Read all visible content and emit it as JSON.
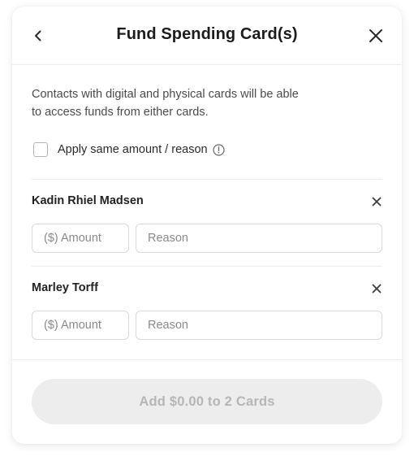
{
  "header": {
    "title": "Fund Spending Card(s)",
    "back_icon": "chevron-left-icon",
    "close_icon": "close-icon"
  },
  "description": "Contacts with digital and physical cards will be able to access funds from either cards.",
  "apply_same": {
    "label": "Apply same amount / reason",
    "checked": false,
    "info_icon": "info-icon"
  },
  "recipients": [
    {
      "name": "Kadin Rhiel Madsen",
      "amount_placeholder": "($) Amount",
      "reason_placeholder": "Reason",
      "remove_icon": "close-icon"
    },
    {
      "name": "Marley Torff",
      "amount_placeholder": "($) Amount",
      "reason_placeholder": "Reason",
      "remove_icon": "close-icon"
    }
  ],
  "submit": {
    "label": "Add $0.00 to 2 Cards",
    "enabled": false
  },
  "colors": {
    "disabled_button_bg": "#ededed",
    "disabled_button_text": "#b6b6b6",
    "border": "#d9d9d9",
    "divider": "#ececec"
  }
}
